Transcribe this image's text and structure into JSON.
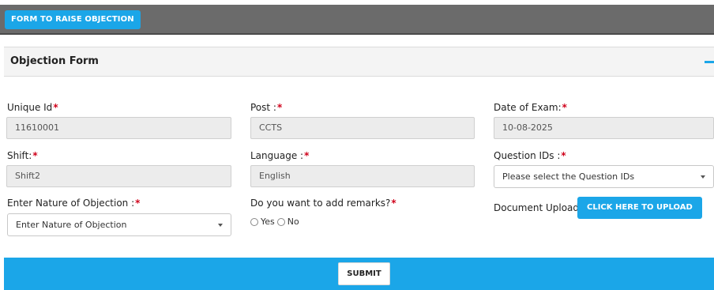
{
  "top_bar": {
    "button_label": "FORM TO RAISE OBJECTION"
  },
  "panel": {
    "title": "Objection Form",
    "collapse_icon": "minus-icon"
  },
  "fields": {
    "unique_id": {
      "label": "Unique Id",
      "required_mark": "*",
      "value": "11610001"
    },
    "post": {
      "label": "Post :",
      "required_mark": "*",
      "value": "CCTS"
    },
    "date_of_exam": {
      "label": "Date of Exam:",
      "required_mark": "*",
      "value": "10-08-2025"
    },
    "shift": {
      "label": "Shift:",
      "required_mark": "*",
      "value": "Shift2"
    },
    "language": {
      "label": "Language :",
      "required_mark": "*",
      "value": "English"
    },
    "question_ids": {
      "label": "Question IDs :",
      "required_mark": "*",
      "selected": "Please select the Question IDs"
    },
    "nature_of_objection": {
      "label": "Enter Nature of Objection :",
      "required_mark": "*",
      "selected": "Enter Nature of Objection"
    },
    "remarks": {
      "label": "Do you want to add remarks?",
      "required_mark": "*",
      "options": [
        "Yes",
        "No"
      ]
    },
    "document_upload": {
      "label": "Document Upload",
      "required_mark": "*",
      "button_label": "CLICK HERE TO UPLOAD"
    }
  },
  "footer": {
    "submit_label": "SUBMIT"
  },
  "colors": {
    "accent": "#1ba6e8",
    "top_bar": "#6b6b6b",
    "required": "#d0021b"
  }
}
